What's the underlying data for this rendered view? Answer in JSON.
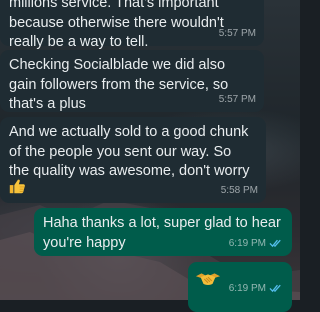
{
  "messages": [
    {
      "direction": "incoming",
      "text": "millions service. That's important\nbecause otherwise there wouldn't\nreally be a way to tell.",
      "time": "5:57 PM"
    },
    {
      "direction": "incoming",
      "text": "Checking Socialblade we did also\ngain followers from the service, so\nthat's a plus",
      "time": "5:57 PM"
    },
    {
      "direction": "incoming",
      "text": "And we actually sold to a good chunk\nof the people you sent our way. So\nthe quality was awesome, don't worry",
      "emoji": "thumbs-up",
      "time": "5:58 PM"
    },
    {
      "direction": "outgoing",
      "text": "Haha thanks a lot, super glad to hear\nyou're happy",
      "time": "6:19 PM",
      "status": "read"
    },
    {
      "direction": "outgoing",
      "emoji": "handshake",
      "time": "6:19 PM",
      "status": "read"
    }
  ],
  "colors": {
    "incoming_bubble": "#1f2c33",
    "outgoing_bubble": "#005c4b",
    "read_ticks": "#53bdeb"
  }
}
